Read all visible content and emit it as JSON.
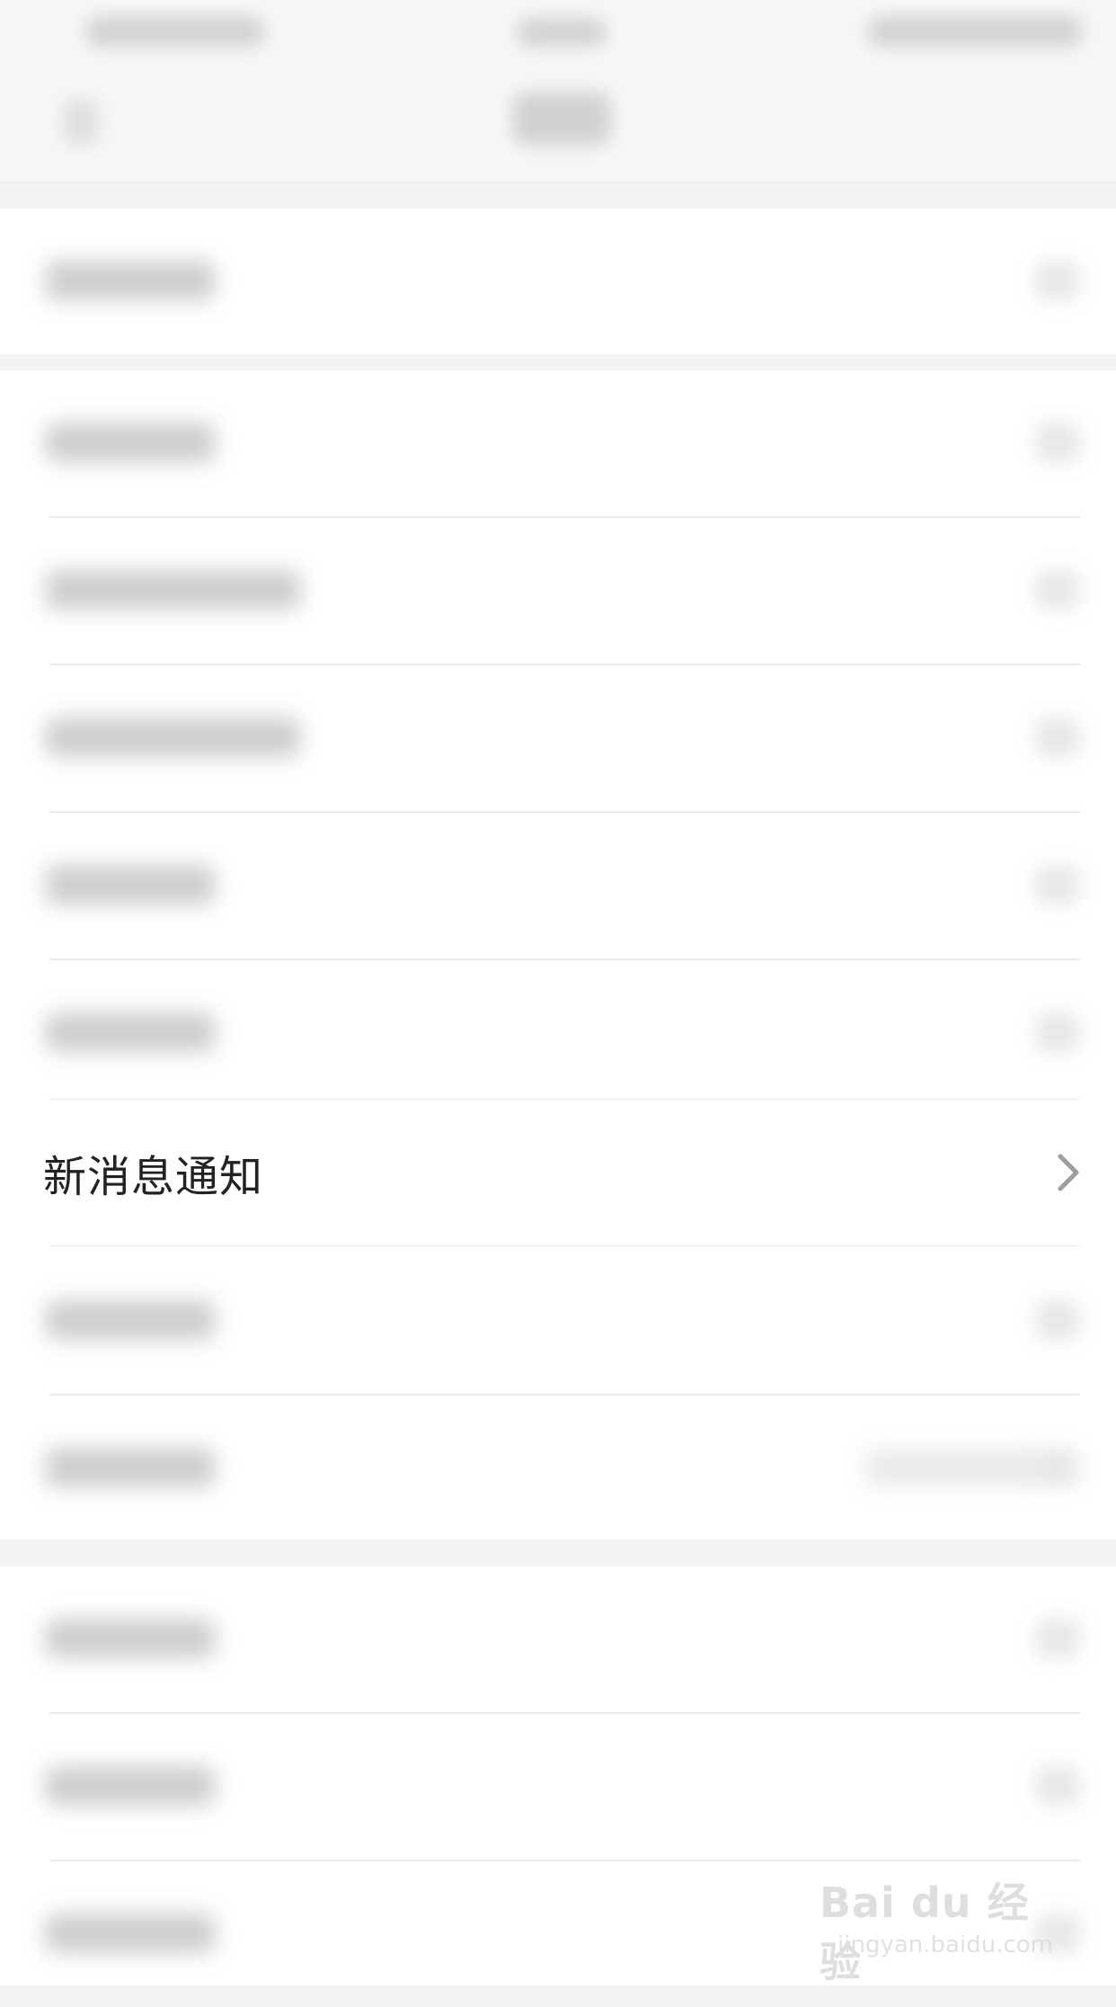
{
  "settings_list": {
    "highlighted_item": {
      "label": "新消息通知"
    }
  },
  "watermark": {
    "brand": "Bai du 经验",
    "url": "jingyan.baidu.com"
  }
}
